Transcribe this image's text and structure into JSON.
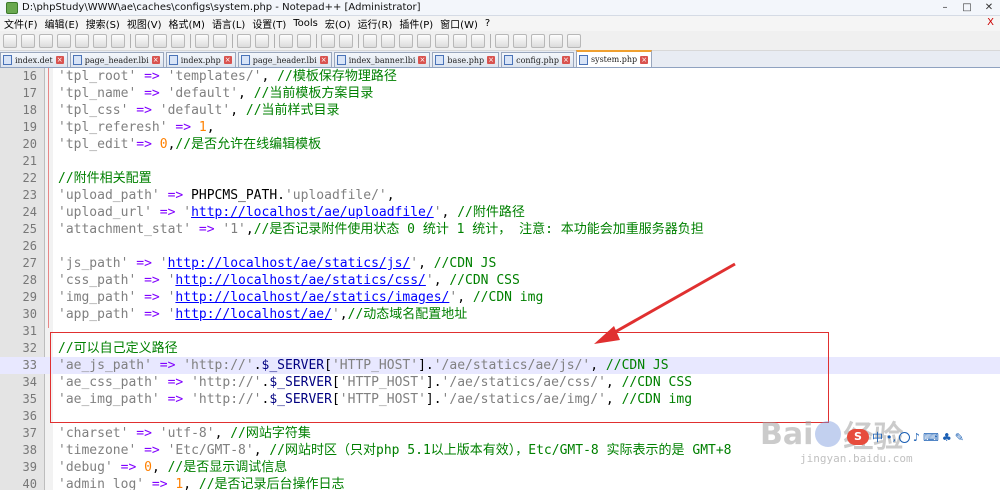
{
  "window": {
    "title": "D:\\phpStudy\\WWW\\ae\\caches\\configs\\system.php - Notepad++ [Administrator]",
    "controls": [
      "–",
      "□",
      "✕"
    ]
  },
  "menu": {
    "items": [
      "文件(F)",
      "编辑(E)",
      "搜索(S)",
      "视图(V)",
      "格式(M)",
      "语言(L)",
      "设置(T)",
      "Tools",
      "宏(O)",
      "运行(R)",
      "插件(P)",
      "窗口(W)",
      "?"
    ],
    "close": "X"
  },
  "tabs": [
    {
      "label": "index.det",
      "active": false
    },
    {
      "label": "page_header.lbi",
      "active": false
    },
    {
      "label": "index.php",
      "active": false
    },
    {
      "label": "page_header.lbi",
      "active": false
    },
    {
      "label": "index_banner.lbi",
      "active": false
    },
    {
      "label": "base.php",
      "active": false
    },
    {
      "label": "config.php",
      "active": false
    },
    {
      "label": "system.php",
      "active": true
    }
  ],
  "lines": [
    {
      "n": "16",
      "segs": [
        [
          "s",
          "'tpl_root'"
        ],
        [
          "p",
          " "
        ],
        [
          "op",
          "=>"
        ],
        [
          "p",
          " "
        ],
        [
          "s",
          "'templates/'"
        ],
        [
          "p",
          ", "
        ],
        [
          "cm",
          "//模板保存物理路径"
        ]
      ]
    },
    {
      "n": "17",
      "segs": [
        [
          "s",
          "'tpl_name'"
        ],
        [
          "p",
          " "
        ],
        [
          "op",
          "=>"
        ],
        [
          "p",
          " "
        ],
        [
          "s",
          "'default'"
        ],
        [
          "p",
          ", "
        ],
        [
          "cm",
          "//当前模板方案目录"
        ]
      ]
    },
    {
      "n": "18",
      "segs": [
        [
          "s",
          "'tpl_css'"
        ],
        [
          "p",
          " "
        ],
        [
          "op",
          "=>"
        ],
        [
          "p",
          " "
        ],
        [
          "s",
          "'default'"
        ],
        [
          "p",
          ", "
        ],
        [
          "cm",
          "//当前样式目录"
        ]
      ]
    },
    {
      "n": "19",
      "segs": [
        [
          "s",
          "'tpl_referesh'"
        ],
        [
          "p",
          " "
        ],
        [
          "op",
          "=>"
        ],
        [
          "p",
          " "
        ],
        [
          "num",
          "1"
        ],
        [
          "p",
          ","
        ]
      ]
    },
    {
      "n": "20",
      "segs": [
        [
          "s",
          "'tpl_edit'"
        ],
        [
          "op",
          "=>"
        ],
        [
          "p",
          " "
        ],
        [
          "num",
          "0"
        ],
        [
          "p",
          ","
        ],
        [
          "cm",
          "//是否允许在线编辑模板"
        ]
      ]
    },
    {
      "n": "21",
      "segs": []
    },
    {
      "n": "22",
      "segs": [
        [
          "cm",
          "//附件相关配置"
        ]
      ]
    },
    {
      "n": "23",
      "segs": [
        [
          "s",
          "'upload_path'"
        ],
        [
          "p",
          " "
        ],
        [
          "op",
          "=>"
        ],
        [
          "p",
          " PHPCMS_PATH."
        ],
        [
          "s",
          "'uploadfile/'"
        ],
        [
          "p",
          ","
        ]
      ]
    },
    {
      "n": "24",
      "segs": [
        [
          "s",
          "'upload_url'"
        ],
        [
          "p",
          " "
        ],
        [
          "op",
          "=>"
        ],
        [
          "p",
          " "
        ],
        [
          "s",
          "'"
        ],
        [
          "url",
          "http://localhost/ae/uploadfile/"
        ],
        [
          "s",
          "'"
        ],
        [
          "p",
          ", "
        ],
        [
          "cm",
          "//附件路径"
        ]
      ]
    },
    {
      "n": "25",
      "segs": [
        [
          "s",
          "'attachment_stat'"
        ],
        [
          "p",
          " "
        ],
        [
          "op",
          "=>"
        ],
        [
          "p",
          " "
        ],
        [
          "s",
          "'1'"
        ],
        [
          "p",
          ","
        ],
        [
          "cm",
          "//是否记录附件使用状态 0 统计 1 统计， 注意: 本功能会加重服务器负担"
        ]
      ]
    },
    {
      "n": "26",
      "segs": []
    },
    {
      "n": "27",
      "segs": [
        [
          "s",
          "'js_path'"
        ],
        [
          "p",
          " "
        ],
        [
          "op",
          "=>"
        ],
        [
          "p",
          " "
        ],
        [
          "s",
          "'"
        ],
        [
          "url",
          "http://localhost/ae/statics/js/"
        ],
        [
          "s",
          "'"
        ],
        [
          "p",
          ", "
        ],
        [
          "cm",
          "//CDN JS"
        ]
      ]
    },
    {
      "n": "28",
      "segs": [
        [
          "s",
          "'css_path'"
        ],
        [
          "p",
          " "
        ],
        [
          "op",
          "=>"
        ],
        [
          "p",
          " "
        ],
        [
          "s",
          "'"
        ],
        [
          "url",
          "http://localhost/ae/statics/css/"
        ],
        [
          "s",
          "'"
        ],
        [
          "p",
          ", "
        ],
        [
          "cm",
          "//CDN CSS"
        ]
      ]
    },
    {
      "n": "29",
      "segs": [
        [
          "s",
          "'img_path'"
        ],
        [
          "p",
          " "
        ],
        [
          "op",
          "=>"
        ],
        [
          "p",
          " "
        ],
        [
          "s",
          "'"
        ],
        [
          "url",
          "http://localhost/ae/statics/images/"
        ],
        [
          "s",
          "'"
        ],
        [
          "p",
          ", "
        ],
        [
          "cm",
          "//CDN img"
        ]
      ]
    },
    {
      "n": "30",
      "segs": [
        [
          "s",
          "'app_path'"
        ],
        [
          "p",
          " "
        ],
        [
          "op",
          "=>"
        ],
        [
          "p",
          " "
        ],
        [
          "s",
          "'"
        ],
        [
          "url",
          "http://localhost/ae/"
        ],
        [
          "s",
          "'"
        ],
        [
          "p",
          ","
        ],
        [
          "cm",
          "//动态域名配置地址"
        ]
      ]
    },
    {
      "n": "31",
      "segs": []
    },
    {
      "n": "32",
      "segs": [
        [
          "cm",
          "//可以自己定义路径"
        ]
      ]
    },
    {
      "n": "33",
      "current": true,
      "segs": [
        [
          "s",
          "'ae_js_path'"
        ],
        [
          "p",
          " "
        ],
        [
          "op",
          "=>"
        ],
        [
          "p",
          " "
        ],
        [
          "s",
          "'http://'"
        ],
        [
          "p",
          "."
        ],
        [
          "var",
          "$_SERVER"
        ],
        [
          "p",
          "["
        ],
        [
          "s",
          "'HTTP_HOST'"
        ],
        [
          "p",
          "]."
        ],
        [
          "s",
          "'/ae/statics/ae/js/'"
        ],
        [
          "p",
          ", "
        ],
        [
          "cm",
          "//CDN JS"
        ]
      ]
    },
    {
      "n": "34",
      "segs": [
        [
          "s",
          "'ae_css_path'"
        ],
        [
          "p",
          " "
        ],
        [
          "op",
          "=>"
        ],
        [
          "p",
          " "
        ],
        [
          "s",
          "'http://'"
        ],
        [
          "p",
          "."
        ],
        [
          "var",
          "$_SERVER"
        ],
        [
          "p",
          "["
        ],
        [
          "s",
          "'HTTP_HOST'"
        ],
        [
          "p",
          "]."
        ],
        [
          "s",
          "'/ae/statics/ae/css/'"
        ],
        [
          "p",
          ", "
        ],
        [
          "cm",
          "//CDN CSS"
        ]
      ]
    },
    {
      "n": "35",
      "segs": [
        [
          "s",
          "'ae_img_path'"
        ],
        [
          "p",
          " "
        ],
        [
          "op",
          "=>"
        ],
        [
          "p",
          " "
        ],
        [
          "s",
          "'http://'"
        ],
        [
          "p",
          "."
        ],
        [
          "var",
          "$_SERVER"
        ],
        [
          "p",
          "["
        ],
        [
          "s",
          "'HTTP_HOST'"
        ],
        [
          "p",
          "]."
        ],
        [
          "s",
          "'/ae/statics/ae/img/'"
        ],
        [
          "p",
          ", "
        ],
        [
          "cm",
          "//CDN img"
        ]
      ]
    },
    {
      "n": "36",
      "segs": []
    },
    {
      "n": "37",
      "segs": [
        [
          "s",
          "'charset'"
        ],
        [
          "p",
          " "
        ],
        [
          "op",
          "=>"
        ],
        [
          "p",
          " "
        ],
        [
          "s",
          "'utf-8'"
        ],
        [
          "p",
          ", "
        ],
        [
          "cm",
          "//网站字符集"
        ]
      ]
    },
    {
      "n": "38",
      "segs": [
        [
          "s",
          "'timezone'"
        ],
        [
          "p",
          " "
        ],
        [
          "op",
          "=>"
        ],
        [
          "p",
          " "
        ],
        [
          "s",
          "'Etc/GMT-8'"
        ],
        [
          "p",
          ", "
        ],
        [
          "cm",
          "//网站时区（只对php 5.1以上版本有效），Etc/GMT-8 实际表示的是 GMT+8"
        ]
      ]
    },
    {
      "n": "39",
      "segs": [
        [
          "s",
          "'debug'"
        ],
        [
          "p",
          " "
        ],
        [
          "op",
          "=>"
        ],
        [
          "p",
          " "
        ],
        [
          "num",
          "0"
        ],
        [
          "p",
          ", "
        ],
        [
          "cm",
          "//是否显示调试信息"
        ]
      ]
    },
    {
      "n": "40",
      "segs": [
        [
          "s",
          "'admin_log'"
        ],
        [
          "p",
          " "
        ],
        [
          "op",
          "=>"
        ],
        [
          "p",
          " "
        ],
        [
          "num",
          "1"
        ],
        [
          "p",
          ", "
        ],
        [
          "cm",
          "//是否记录后台操作日志"
        ]
      ]
    }
  ],
  "watermark": {
    "text": "Bai",
    "text2": "经验",
    "sub": "jingyan.baidu.com"
  },
  "ime": {
    "logo": "S",
    "mode": "中"
  },
  "colors": {
    "highlight_box": "#e03030",
    "comment": "#008000",
    "string": "#808080",
    "operator": "#8000ff",
    "number": "#ff8000",
    "url": "#0000ff"
  }
}
